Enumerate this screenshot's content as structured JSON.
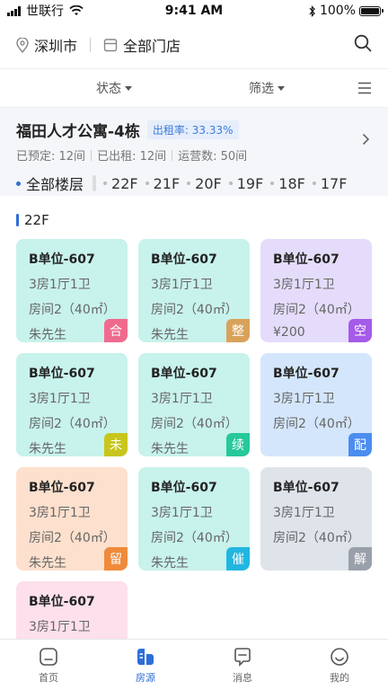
{
  "status": {
    "carrier": "世联行",
    "time": "9:41 AM",
    "battery": "100%"
  },
  "header": {
    "city": "深圳市",
    "store": "全部门店"
  },
  "filters": {
    "status": "状态",
    "filter": "筛选"
  },
  "building": {
    "name": "福田人才公寓-4栋",
    "rate_label": "出租率: 33.33%",
    "reserved": "已预定: 12间",
    "rented": "已出租: 12间",
    "operating": "运营数: 50间"
  },
  "floors": {
    "all": "全部楼层",
    "list": [
      "22F",
      "21F",
      "20F",
      "19F",
      "18F",
      "17F"
    ]
  },
  "section": {
    "floor": "22F"
  },
  "cards": [
    {
      "unit": "B单位-607",
      "layout": "3房1厅1卫",
      "room": "房间2（40㎡）",
      "extra": "朱先生",
      "tag": "合",
      "bg": "#c8f2ec",
      "tagColor": "#f06a8e"
    },
    {
      "unit": "B单位-607",
      "layout": "3房1厅1卫",
      "room": "房间2（40㎡）",
      "extra": "朱先生",
      "tag": "整",
      "bg": "#c8f2ec",
      "tagColor": "#d9a25a"
    },
    {
      "unit": "B单位-607",
      "layout": "3房1厅1卫",
      "room": "房间2（40㎡）",
      "extra": "¥200",
      "tag": "空",
      "bg": "#e5dcfb",
      "tagColor": "#a55be8"
    },
    {
      "unit": "B单位-607",
      "layout": "3房1厅1卫",
      "room": "房间2（40㎡）",
      "extra": "朱先生",
      "tag": "未",
      "bg": "#c8f2ec",
      "tagColor": "#c8c61d"
    },
    {
      "unit": "B单位-607",
      "layout": "3房1厅1卫",
      "room": "房间2（40㎡）",
      "extra": "朱先生",
      "tag": "续",
      "bg": "#c8f2ec",
      "tagColor": "#27c89a"
    },
    {
      "unit": "B单位-607",
      "layout": "3房1厅1卫",
      "room": "房间2（40㎡）",
      "extra": "",
      "tag": "配",
      "bg": "#d4e6fb",
      "tagColor": "#4b8df0"
    },
    {
      "unit": "B单位-607",
      "layout": "3房1厅1卫",
      "room": "房间2（40㎡）",
      "extra": "朱先生",
      "tag": "留",
      "bg": "#fde0cd",
      "tagColor": "#f08a3b"
    },
    {
      "unit": "B单位-607",
      "layout": "3房1厅1卫",
      "room": "房间2（40㎡）",
      "extra": "朱先生",
      "tag": "催",
      "bg": "#c8f2ec",
      "tagColor": "#21b6e0"
    },
    {
      "unit": "B单位-607",
      "layout": "3房1厅1卫",
      "room": "房间2（40㎡）",
      "extra": "",
      "tag": "解",
      "bg": "#dfe3ea",
      "tagColor": "#9aa0aa"
    },
    {
      "unit": "B单位-607",
      "layout": "3房1厅1卫",
      "room": "",
      "extra": "",
      "tag": "",
      "bg": "#fde0ec",
      "tagColor": ""
    }
  ],
  "tabs": [
    {
      "label": "首页",
      "icon": "home-icon",
      "active": false
    },
    {
      "label": "房源",
      "icon": "listing-icon",
      "active": true
    },
    {
      "label": "消息",
      "icon": "message-icon",
      "active": false
    },
    {
      "label": "我的",
      "icon": "profile-icon",
      "active": false
    }
  ],
  "colors": {
    "accent": "#2d6fd8"
  }
}
